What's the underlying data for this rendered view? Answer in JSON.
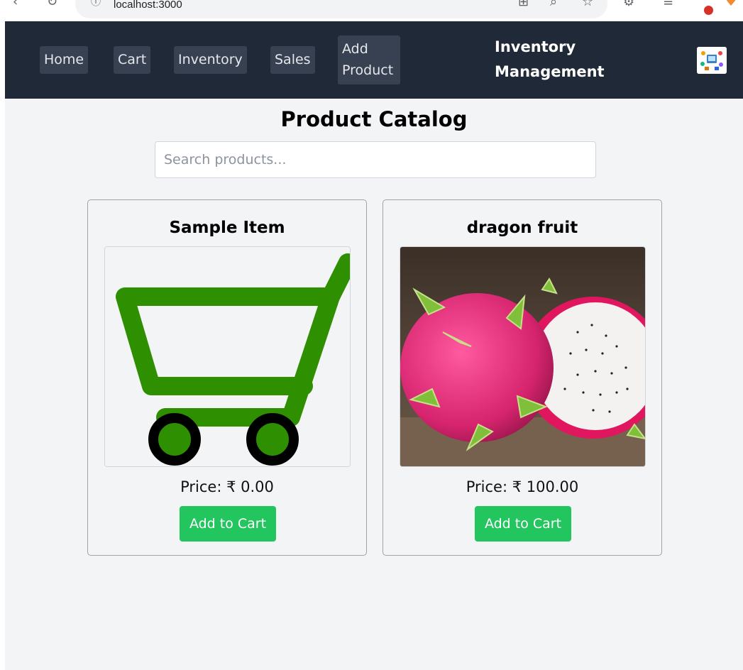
{
  "browser": {
    "url": "localhost:3000"
  },
  "nav": {
    "home": "Home",
    "cart": "Cart",
    "inventory": "Inventory",
    "sales": "Sales",
    "add_product": "Add Product",
    "brand": "Inventory Management"
  },
  "catalog": {
    "title": "Product Catalog",
    "search_placeholder": "Search products..."
  },
  "products": [
    {
      "name": "Sample Item",
      "price": "Price: ₹ 0.00",
      "button": "Add to Cart",
      "image_icon": "shopping-cart-icon"
    },
    {
      "name": "dragon fruit",
      "price": "Price: ₹ 100.00",
      "button": "Add to Cart",
      "image_icon": "dragon-fruit-photo"
    }
  ],
  "colors": {
    "navbar": "#1f2937",
    "nav_button": "#374151",
    "add_button": "#22c55e",
    "cart_green": "#2e8f00"
  }
}
